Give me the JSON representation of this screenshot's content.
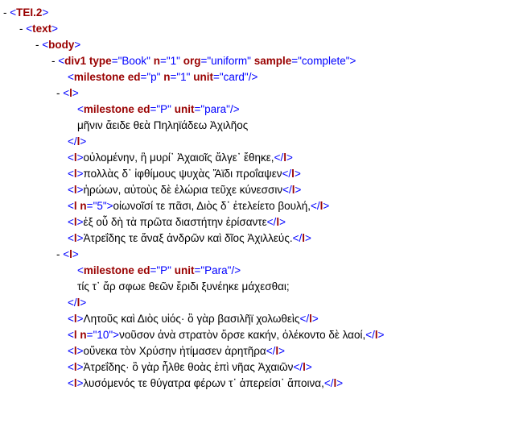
{
  "lines": [
    {
      "indent": 0,
      "mark": "- ",
      "tag": "<",
      "name": "TEI.2",
      "attrs": [],
      "close": ">"
    },
    {
      "indent": 1,
      "mark": "- ",
      "tag": "<",
      "name": "text",
      "attrs": [],
      "close": ">"
    },
    {
      "indent": 2,
      "mark": "- ",
      "tag": "<",
      "name": "body",
      "attrs": [],
      "close": ">"
    },
    {
      "indent": 3,
      "mark": "- ",
      "tag": "<",
      "name": "div1",
      "attrs": [
        {
          "n": "type",
          "v": "\"Book\""
        },
        {
          "n": "n",
          "v": "\"1\""
        },
        {
          "n": "org",
          "v": "\"uniform\""
        },
        {
          "n": "sample",
          "v": "\"complete\""
        }
      ],
      "close": ">"
    },
    {
      "indent": 4,
      "tag": "<",
      "name": "milestone",
      "attrs": [
        {
          "n": "ed",
          "v": "\"p\""
        },
        {
          "n": "n",
          "v": "\"1\""
        },
        {
          "n": "unit",
          "v": "\"card\""
        }
      ],
      "close": "/>"
    },
    {
      "indent": 3.3,
      "mark": "- ",
      "tag": "<",
      "name": "l",
      "attrs": [],
      "close": ">"
    },
    {
      "indent": 4.6,
      "tag": "<",
      "name": "milestone",
      "attrs": [
        {
          "n": "ed",
          "v": "\"P\""
        },
        {
          "n": "unit",
          "v": "\"para\""
        }
      ],
      "close": "/>"
    },
    {
      "indent": 4.6,
      "text": "μῆνιν ἄειδε θεὰ Πηληϊάδεω Ἀχιλῆος"
    },
    {
      "indent": 4,
      "tag": "</",
      "name": "l",
      "attrs": [],
      "close": ">"
    },
    {
      "indent": 4,
      "tag": "<",
      "name": "l",
      "attrs": [],
      "close": ">",
      "text": "οὐλομένην, ἣ μυρί᾽ Ἀχαιοῖς ἄλγε᾽ ἔθηκε,",
      "end": "l"
    },
    {
      "indent": 4,
      "tag": "<",
      "name": "l",
      "attrs": [],
      "close": ">",
      "text": "πολλὰς δ᾽ ἰφθίμους ψυχὰς Ἄϊδι προΐαψεν",
      "end": "l"
    },
    {
      "indent": 4,
      "tag": "<",
      "name": "l",
      "attrs": [],
      "close": ">",
      "text": "ἡρώων, αὐτοὺς δὲ ἑλώρια τεῦχε κύνεσσιν",
      "end": "l"
    },
    {
      "indent": 4,
      "tag": "<",
      "name": "l",
      "attrs": [
        {
          "n": "n",
          "v": "\"5\""
        }
      ],
      "close": ">",
      "text": "οἰωνοῖσί τε πᾶσι, Διὸς δ᾽ ἐτελείετο βουλή,",
      "end": "l"
    },
    {
      "indent": 4,
      "tag": "<",
      "name": "l",
      "attrs": [],
      "close": ">",
      "text": "ἐξ οὗ δὴ τὰ πρῶτα διαστήτην ἐρίσαντε",
      "end": "l"
    },
    {
      "indent": 4,
      "tag": "<",
      "name": "l",
      "attrs": [],
      "close": ">",
      "text": "Ἀτρεΐδης τε ἄναξ ἀνδρῶν καὶ δῖος Ἀχιλλεύς.",
      "end": "l"
    },
    {
      "indent": 3.3,
      "mark": "- ",
      "tag": "<",
      "name": "l",
      "attrs": [],
      "close": ">"
    },
    {
      "indent": 4.6,
      "tag": "<",
      "name": "milestone",
      "attrs": [
        {
          "n": "ed",
          "v": "\"P\""
        },
        {
          "n": "unit",
          "v": "\"Para\""
        }
      ],
      "close": "/>"
    },
    {
      "indent": 4.6,
      "text": "τίς τ᾽ ἄρ σφωε θεῶν ἔριδι ξυνέηκε μάχεσθαι;"
    },
    {
      "indent": 4,
      "tag": "</",
      "name": "l",
      "attrs": [],
      "close": ">"
    },
    {
      "indent": 4,
      "tag": "<",
      "name": "l",
      "attrs": [],
      "close": ">",
      "text": "Λητοῦς καὶ Διὸς υἱός· ὃ γὰρ βασιλῆϊ χολωθεὶς",
      "end": "l"
    },
    {
      "indent": 4,
      "tag": "<",
      "name": "l",
      "attrs": [
        {
          "n": "n",
          "v": "\"10\""
        }
      ],
      "close": ">",
      "text": "νοῦσον ἀνὰ στρατὸν ὄρσε κακήν, ὀλέκοντο δὲ λαοί,",
      "end": "l"
    },
    {
      "indent": 4,
      "tag": "<",
      "name": "l",
      "attrs": [],
      "close": ">",
      "text": "οὕνεκα τὸν Χρύσην ἠτίμασεν ἀρητῆρα",
      "end": "l"
    },
    {
      "indent": 4,
      "tag": "<",
      "name": "l",
      "attrs": [],
      "close": ">",
      "text": "Ἀτρεΐδης· ὃ γὰρ ἦλθε θοὰς ἐπὶ νῆας Ἀχαιῶν",
      "end": "l"
    },
    {
      "indent": 4,
      "tag": "<",
      "name": "l",
      "attrs": [],
      "close": ">",
      "text": "λυσόμενός τε θύγατρα φέρων τ᾽ ἀπερείσι᾽ ἄποινα,",
      "end": "l"
    }
  ]
}
